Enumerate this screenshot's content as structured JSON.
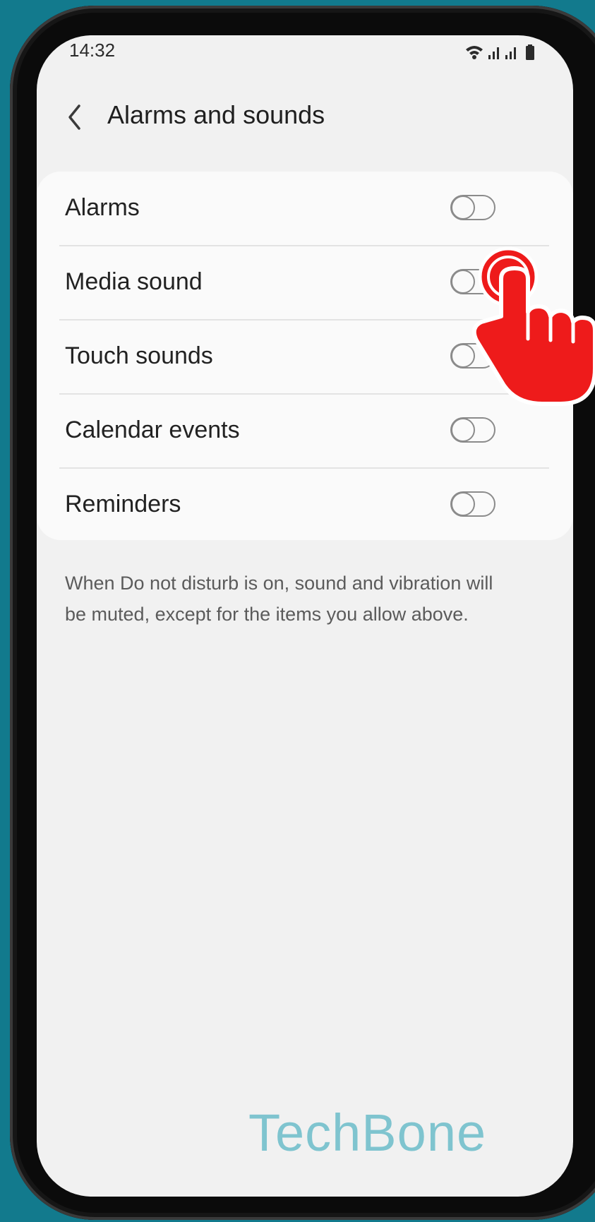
{
  "status_bar": {
    "time": "14:32",
    "icons": [
      "wifi-icon",
      "signal-icon",
      "signal-icon",
      "battery-icon"
    ]
  },
  "header": {
    "title": "Alarms and sounds",
    "back_icon": "chevron-left-icon"
  },
  "settings": [
    {
      "label": "Alarms",
      "enabled": false
    },
    {
      "label": "Media sound",
      "enabled": false
    },
    {
      "label": "Touch sounds",
      "enabled": false
    },
    {
      "label": "Calendar events",
      "enabled": false
    },
    {
      "label": "Reminders",
      "enabled": false
    }
  ],
  "note": "When Do not disturb is on, sound and vibration will be muted, except for the items you allow above.",
  "watermark": "TechBone",
  "colors": {
    "background": "#127a8d",
    "screen": "#f1f1f1",
    "card": "#fafafa",
    "hand": "#ee1b1b",
    "watermark": "#7fc4cf"
  }
}
